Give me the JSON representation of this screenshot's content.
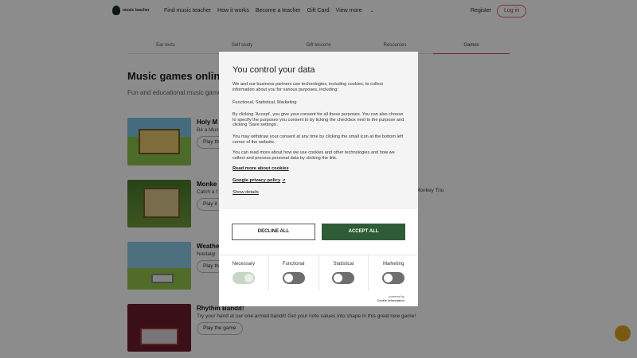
{
  "header": {
    "logo_text": "music teacher",
    "nav": [
      "Find music teacher",
      "How it works",
      "Become a teacher",
      "Gift Card",
      "View more"
    ],
    "register": "Register",
    "login": "Log in"
  },
  "tabs": [
    "Ear tests",
    "Self study",
    "Gift lessons",
    "Resources",
    "Games"
  ],
  "main": {
    "title": "Music games online",
    "subtitle": "Fun and educational music games",
    "games": [
      {
        "name": "Holy M",
        "desc": "Be a Mus",
        "play": "Play th"
      },
      {
        "name": "Monke",
        "desc": "Catch a f",
        "play": "Play it"
      },
      {
        "name": "Weathe",
        "desc": "Nostalgi",
        "play": "Play th"
      },
      {
        "name": "Rhythm Bandit!",
        "desc": "Try your hand at our one armed bandit! Get your note values into shape in this great new game!",
        "play": "Play the game"
      }
    ],
    "extra_text": "Monkey Trio"
  },
  "modal": {
    "title": "You control your data",
    "p1": "We and our business partners use technologies, including cookies, to collect information about you for various purposes, including:",
    "p2": "Functional, Statistical, Marketing",
    "p3": "By clicking 'Accept', you give your consent for all these purposes. You can also choose to specify the purposes you consent to by ticking the checkbox next to the purpose and clicking 'Save settings'.",
    "p4": "You may withdraw your consent at any time by clicking the small icon at the bottom left corner of the website.",
    "p5": "You can read more about how we use cookies and other technologies and how we collect and process personal data by clicking the link.",
    "link_cookies": "Read more about cookies",
    "link_google": "Google privacy policy",
    "link_details": "Show details",
    "decline": "DECLINE ALL",
    "accept": "ACCEPT ALL",
    "categories": [
      {
        "label": "Necessary",
        "on": true
      },
      {
        "label": "Functional",
        "on": false
      },
      {
        "label": "Statistical",
        "on": false
      },
      {
        "label": "Marketing",
        "on": false
      }
    ],
    "powered_by": "powered by",
    "powered_name": "Cookie Information"
  },
  "colors": {
    "accept": "#2e5c36",
    "accent": "#c44444",
    "chat": "#e0a01c"
  }
}
